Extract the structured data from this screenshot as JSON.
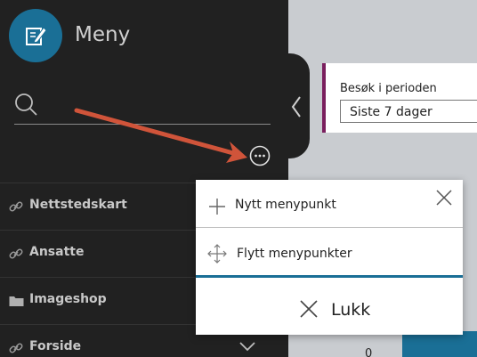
{
  "sidebar": {
    "title": "Meny",
    "search": {
      "placeholder": "",
      "value": ""
    },
    "items": [
      {
        "label": "Nettstedskart",
        "icon": "link-icon"
      },
      {
        "label": "Ansatte",
        "icon": "link-icon"
      },
      {
        "label": "Imageshop",
        "icon": "folder-icon"
      },
      {
        "label": "Forside",
        "icon": "link-icon"
      }
    ]
  },
  "content": {
    "card_label": "Besøk i perioden",
    "select_value": "Siste 7 dager",
    "axis_zero": "0"
  },
  "popup": {
    "new_item": "Nytt menypunkt",
    "move_items": "Flytt menypunkter",
    "close": "Lukk"
  },
  "colors": {
    "sidebar_bg": "#212121",
    "accent_blue": "#1a6f96",
    "card_accent": "#7a1f5e",
    "arrow": "#d0543a"
  }
}
